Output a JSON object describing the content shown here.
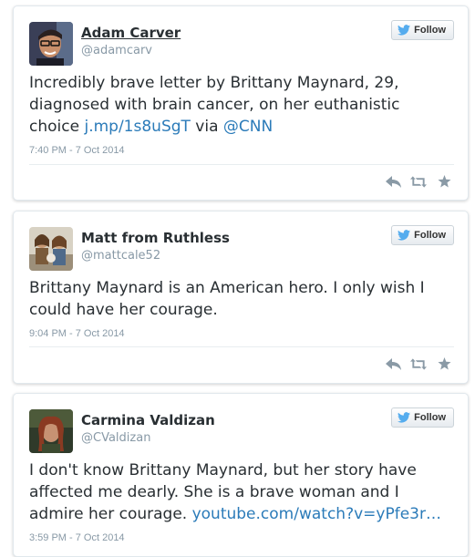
{
  "colors": {
    "link": "#2b7bb9",
    "twitter_blue": "#55acee",
    "meta_gray": "#8899a6",
    "action_gray": "#8a9aa6",
    "text": "#292f33"
  },
  "tweets": [
    {
      "author_name": "Adam Carver",
      "author_handle": "@adamcarv",
      "follow_label": "Follow",
      "text_parts": {
        "pre": "Incredibly brave letter by Brittany Maynard, 29, diagnosed with brain cancer, on her euthanistic choice ",
        "link1": "j.mp/1s8uSgT",
        "mid": " via ",
        "link2": "@CNN"
      },
      "timestamp": "7:40 PM - 7 Oct 2014",
      "avatar_icon": "avatar-man-glasses",
      "actions": [
        "reply-icon",
        "retweet-icon",
        "favorite-icon"
      ]
    },
    {
      "author_name": "Matt from Ruthless",
      "author_handle": "@mattcale52",
      "follow_label": "Follow",
      "text": "Brittany Maynard is an American hero. I only wish I could have her courage.",
      "timestamp": "9:04 PM - 7 Oct 2014",
      "avatar_icon": "avatar-group-photo",
      "actions": [
        "reply-icon",
        "retweet-icon",
        "favorite-icon"
      ]
    },
    {
      "author_name": "Carmina Valdizan",
      "author_handle": "@CValdizan",
      "follow_label": "Follow",
      "text_parts": {
        "pre": "I don't know Brittany Maynard, but her story have affected me dearly. She is a brave woman and I admire her courage. ",
        "link1": "youtube.com/watch?v=yPfe3r…"
      },
      "timestamp": "3:59 PM - 7 Oct 2014",
      "avatar_icon": "avatar-woman-painting"
    }
  ]
}
